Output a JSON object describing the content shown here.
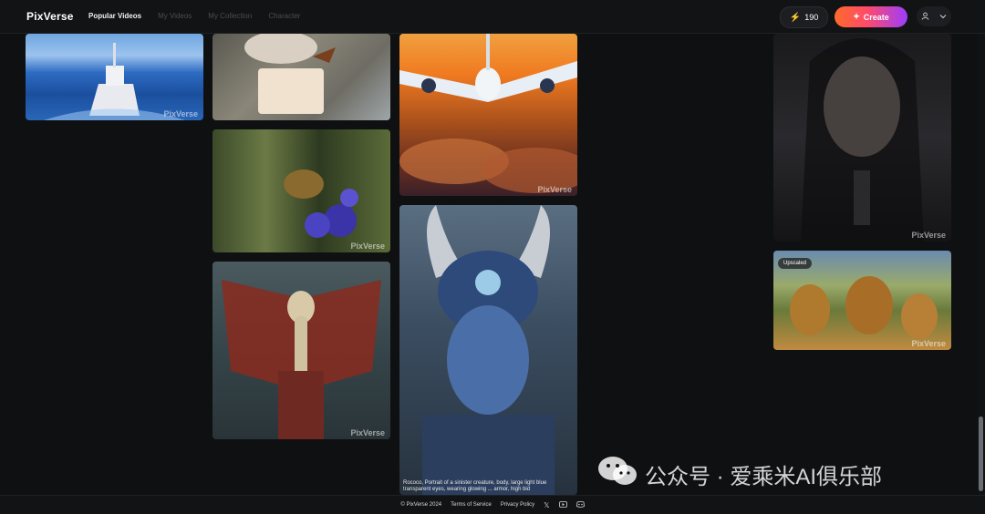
{
  "header": {
    "logo": "PixVerse",
    "nav": [
      "Popular Videos",
      "My Videos",
      "My Collection",
      "Character"
    ],
    "credits": "190",
    "create_label": "Create"
  },
  "cards": [
    {
      "watermark": "PixVerse"
    },
    {
      "watermark": ""
    },
    {
      "watermark": "PixVerse"
    },
    {
      "watermark": "PixVerse"
    },
    {
      "watermark": "PixVerse"
    },
    {
      "watermark": "PixVerse",
      "caption": "Rococo, Portrait of a sinister creature, body, large light blue transparent eyes, wearing glowing ... armor, high bid"
    },
    {
      "watermark": "PixVerse"
    },
    {
      "watermark": "PixVerse",
      "badge": "Upscaled"
    }
  ],
  "footer": {
    "copyright": "© PixVerse 2024",
    "terms": "Terms of Service",
    "privacy": "Privacy Policy"
  },
  "overlay": {
    "brand_text": "公众号 · 爱乘米AI俱乐部"
  },
  "icons": [
    "bolt-icon",
    "sparkle-icon",
    "user-icon",
    "chevron-down-icon",
    "x-icon",
    "youtube-icon",
    "discord-icon",
    "wechat-icon"
  ]
}
